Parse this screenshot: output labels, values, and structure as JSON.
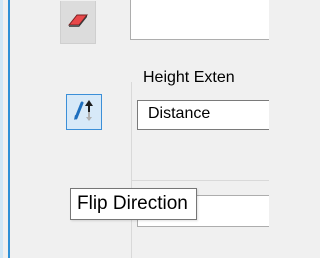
{
  "toolbar": {
    "eraser_icon": "eraser-icon",
    "flip_icon": "flip-direction-icon"
  },
  "height_extension": {
    "label": "Height Exten",
    "selected_value": "Distance"
  },
  "tooltip": {
    "text": "Flip Direction"
  },
  "colors": {
    "accent": "#2d8fd6",
    "eraser_red": "#e8484a",
    "flip_blue": "#1d6fbf",
    "pressed_bg": "#d7e9f8"
  }
}
